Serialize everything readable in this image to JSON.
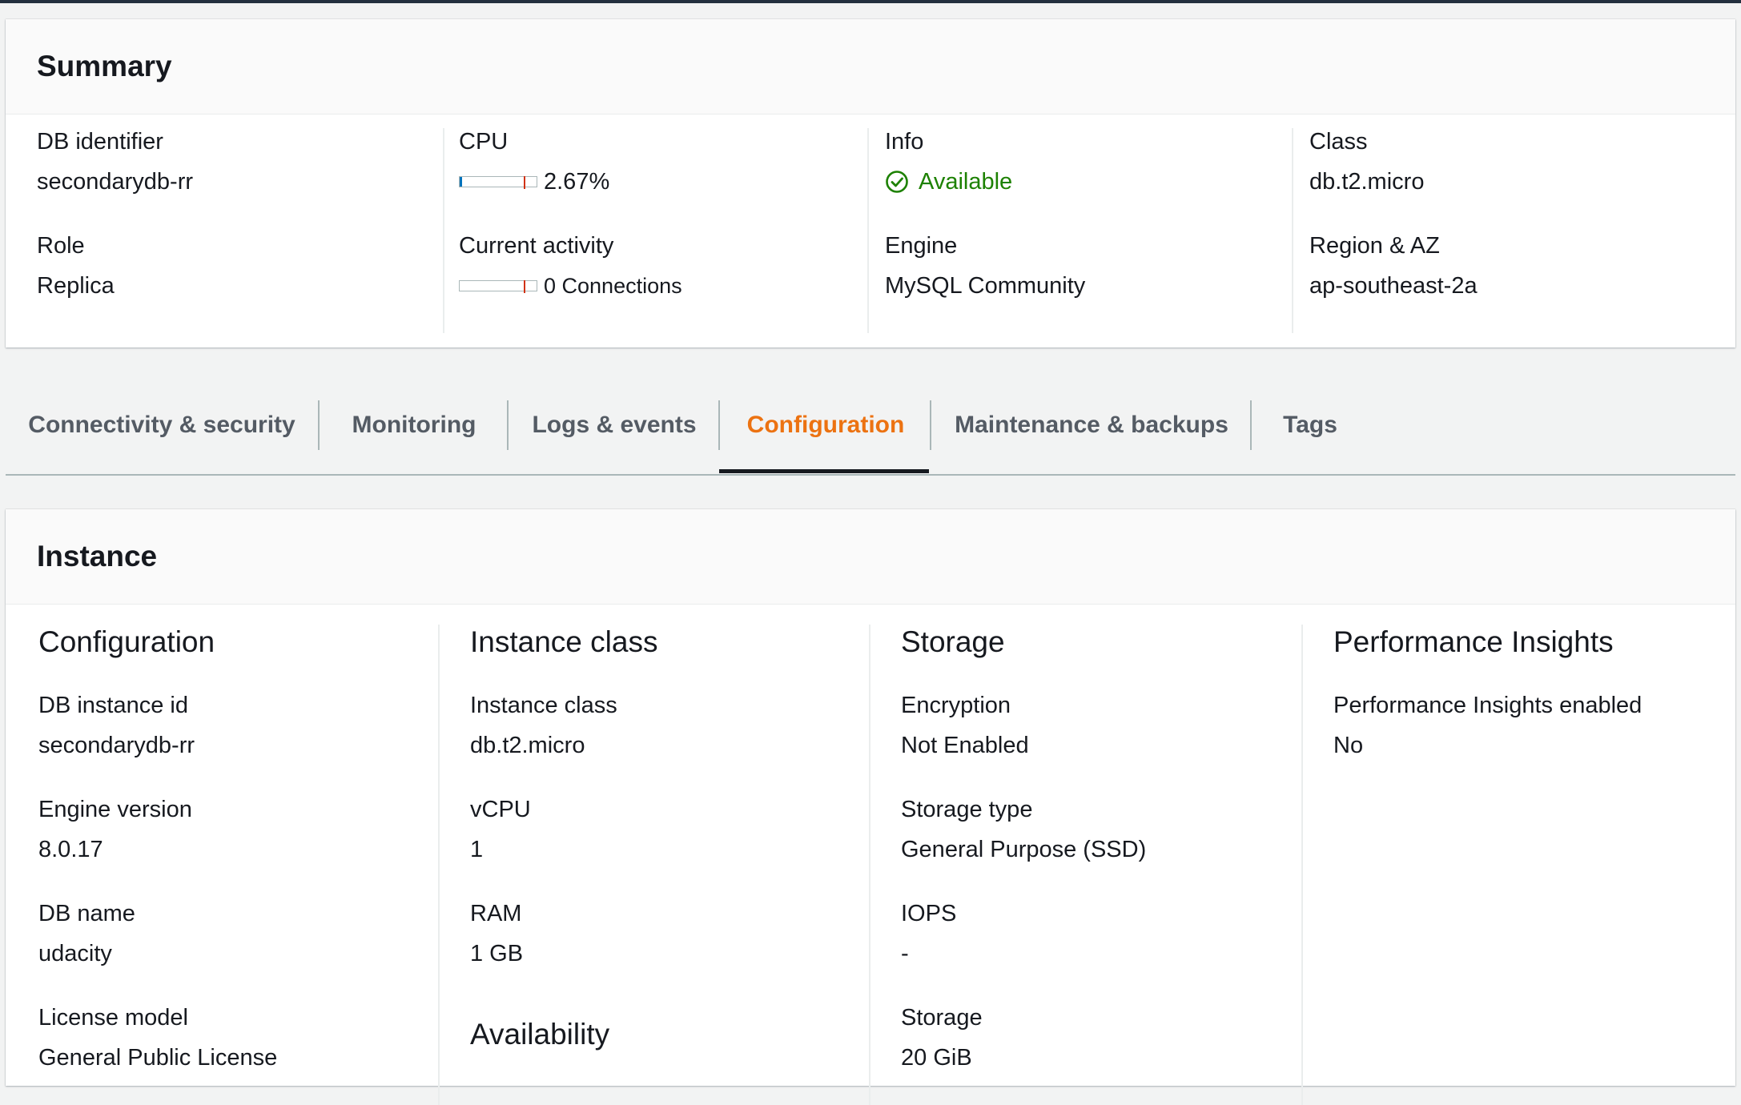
{
  "summary": {
    "title": "Summary",
    "db_identifier_label": "DB identifier",
    "db_identifier": "secondarydb-rr",
    "role_label": "Role",
    "role": "Replica",
    "cpu_label": "CPU",
    "cpu_value": "2.67%",
    "cpu_fraction": 0.0267,
    "activity_label": "Current activity",
    "activity_value": "0 Connections",
    "activity_fraction": 0,
    "info_label": "Info",
    "info_value": "Available",
    "engine_label": "Engine",
    "engine_value": "MySQL Community",
    "class_label": "Class",
    "class_value": "db.t2.micro",
    "region_label": "Region & AZ",
    "region_value": "ap-southeast-2a"
  },
  "tabs": [
    {
      "label": "Connectivity & security"
    },
    {
      "label": "Monitoring"
    },
    {
      "label": "Logs & events"
    },
    {
      "label": "Configuration",
      "active": true
    },
    {
      "label": "Maintenance & backups"
    },
    {
      "label": "Tags"
    }
  ],
  "instance": {
    "title": "Instance",
    "configuration": {
      "title": "Configuration",
      "items": [
        {
          "label": "DB instance id",
          "value": "secondarydb-rr"
        },
        {
          "label": "Engine version",
          "value": "8.0.17"
        },
        {
          "label": "DB name",
          "value": "udacity"
        },
        {
          "label": "License model",
          "value": "General Public License"
        }
      ]
    },
    "instance_class": {
      "title": "Instance class",
      "items": [
        {
          "label": "Instance class",
          "value": "db.t2.micro"
        },
        {
          "label": "vCPU",
          "value": "1"
        },
        {
          "label": "RAM",
          "value": "1 GB"
        }
      ],
      "availability_title": "Availability"
    },
    "storage": {
      "title": "Storage",
      "items": [
        {
          "label": "Encryption",
          "value": "Not Enabled"
        },
        {
          "label": "Storage type",
          "value": "General Purpose (SSD)"
        },
        {
          "label": "IOPS",
          "value": "-"
        },
        {
          "label": "Storage",
          "value": "20 GiB"
        }
      ]
    },
    "performance_insights": {
      "title": "Performance Insights",
      "items": [
        {
          "label": "Performance Insights enabled",
          "value": "No"
        }
      ]
    }
  },
  "colors": {
    "accent": "#ec7211",
    "status_ok": "#1d8102",
    "meter_fill": "#0073bb",
    "meter_threshold": "#d13212"
  },
  "icons": {
    "status": "check-circle-icon"
  }
}
